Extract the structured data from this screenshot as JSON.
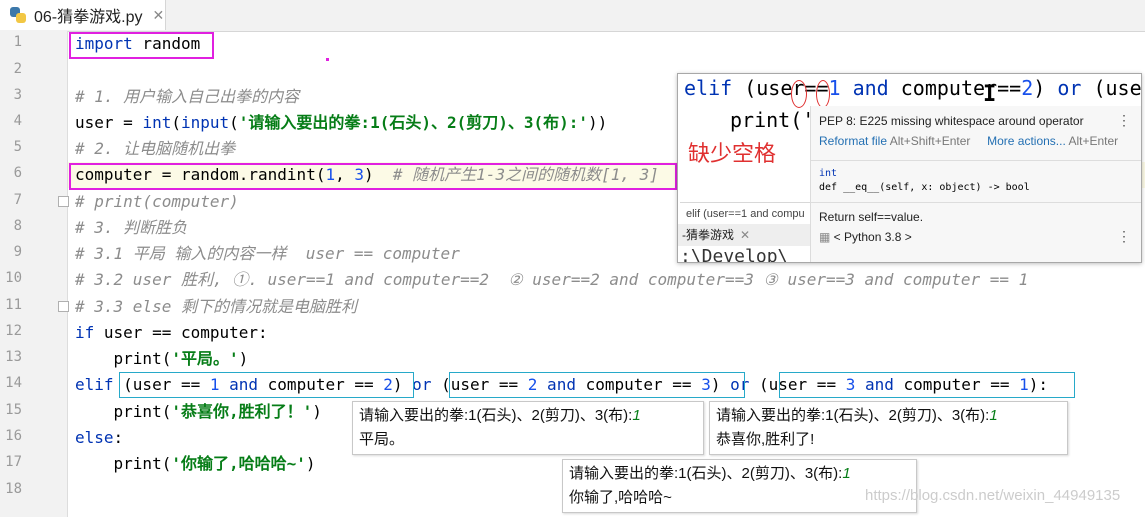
{
  "tab": {
    "title": "06-猜拳游戏.py",
    "close": "✕",
    "icon": "python-file-icon"
  },
  "line_numbers": [
    "1",
    "2",
    "3",
    "4",
    "5",
    "6",
    "7",
    "8",
    "9",
    "10",
    "11",
    "12",
    "13",
    "14",
    "15",
    "16",
    "17",
    "18"
  ],
  "code": {
    "l1_kw": "import",
    "l1_rest": " random",
    "l3": "# 1. 用户输入自己出拳的内容",
    "l4_a": "user = ",
    "l4_int": "int",
    "l4_b": "(",
    "l4_input": "input",
    "l4_c": "(",
    "l4_str": "'请输入要出的拳:1(石头)、2(剪刀)、3(布):'",
    "l4_d": "))",
    "l5": "# 2. 让电脑随机出拳",
    "l6_a": "computer = random.randint(",
    "l6_n1": "1",
    "l6_b": ", ",
    "l6_n2": "3",
    "l6_c": ")  ",
    "l6_cmt": "# 随机产生1-3之间的随机数[1, 3]",
    "l7": "# print(computer)",
    "l8": "# 3. 判断胜负",
    "l9": "# 3.1 平局 输入的内容一样  user == computer",
    "l10": "# 3.2 user 胜利, ①. user==1 and computer==2  ② user==2 and computer==3 ③ user==3 and computer == 1",
    "l11": "# 3.3 else 剩下的情况就是电脑胜利",
    "l12_kw": "if",
    "l12_rest": " user == computer:",
    "l13_a": "    print(",
    "l13_str": "'平局。'",
    "l13_b": ")",
    "l14_elif": "elif",
    "l14_s1": " (user == ",
    "l14_n1": "1",
    "l14_and1": " and",
    "l14_s2": " computer == ",
    "l14_n2": "2",
    "l14_p1": ")",
    "l14_or1": " or",
    "l14_s3": " (user == ",
    "l14_n3": "2",
    "l14_and2": " and",
    "l14_s4": " computer == ",
    "l14_n4": "3",
    "l14_p2": ")",
    "l14_or2": " or",
    "l14_s5": " (user == ",
    "l14_n5": "3",
    "l14_and3": " and",
    "l14_s6": " computer == ",
    "l14_n6": "1",
    "l14_p3": "):",
    "l15_a": "    print(",
    "l15_str": "'恭喜你,胜利了！'",
    "l15_b": ")",
    "l16_kw": "else",
    "l16_rest": ":",
    "l17_a": "    print(",
    "l17_str": "'你输了,哈哈哈~'",
    "l17_b": ")"
  },
  "outputs": [
    {
      "prompt": "请输入要出的拳:1(石头)、2(剪刀)、3(布):",
      "input": "1",
      "result": "平局。"
    },
    {
      "prompt": "请输入要出的拳:1(石头)、2(剪刀)、3(布):",
      "input": "1",
      "result": "恭喜你,胜利了!"
    },
    {
      "prompt": "请输入要出的拳:1(石头)、2(剪刀)、3(布):",
      "input": "1",
      "result": "你输了,哈哈哈~"
    }
  ],
  "popup": {
    "code_elif": "elif",
    "code_a": " (user==",
    "code_n1": "1",
    "code_and": " and",
    "code_b": " computer",
    "code_c": "==",
    "code_n2": "2",
    "code_d": ") ",
    "code_or": "or",
    "code_e": " (user==",
    "print_line": "print('",
    "red_note": "缺少空格",
    "cursor": "I",
    "inspection": "PEP 8: E225 missing whitespace around operator",
    "reformat": "Reformat file",
    "reformat_hint": "Alt+Shift+Enter",
    "more": "More actions...",
    "more_hint": "Alt+Enter",
    "sig_type": "int",
    "sig_def": "def __eq__(self, x: object) -> bool",
    "doc": "Return self==value.",
    "python": "< Python 3.8 >",
    "sub_line": "elif (user==1 and compu",
    "sub_tab": "-猜拳游戏",
    "sub_tab_close": "✕",
    "sub_path": ":\\Develop\\"
  },
  "watermark": "https://blog.csdn.net/weixin_44949135",
  "colors": {
    "highlight_magenta": "#e020e0",
    "highlight_cyan": "#27a9c9",
    "keyword": "#0033b3",
    "string": "#067d17",
    "number": "#1750eb",
    "comment": "#8c8c8c",
    "red_note": "#e03030"
  }
}
